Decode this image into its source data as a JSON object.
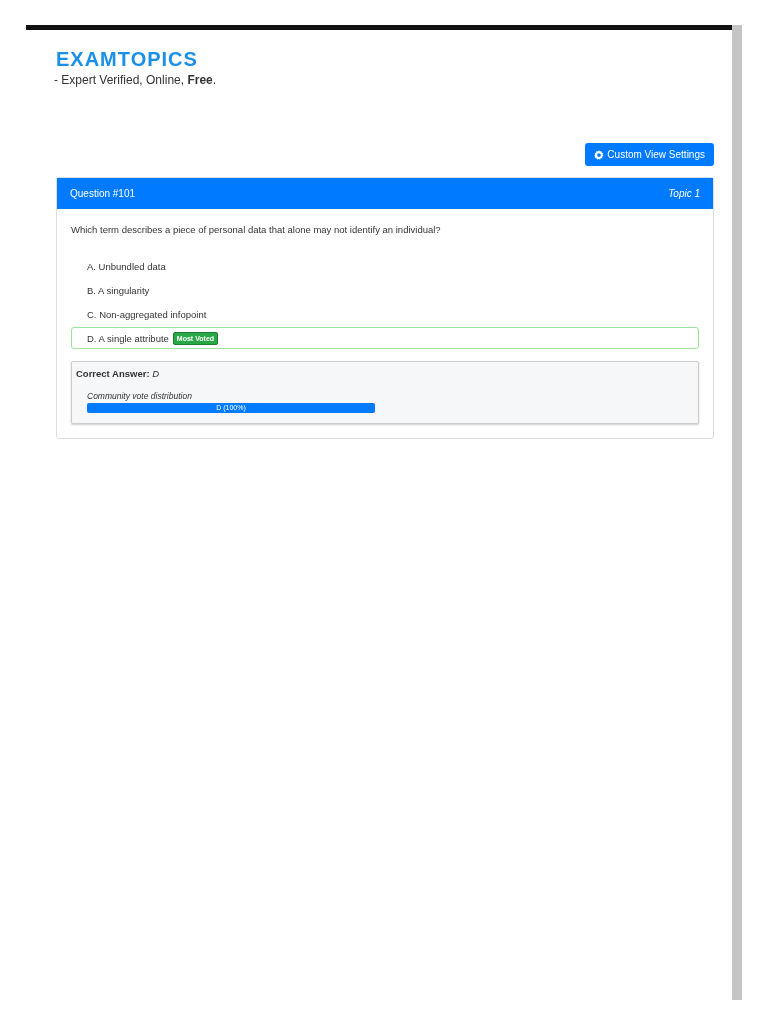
{
  "logo": "EXAMTOPICS",
  "tagline": "- Expert Verified, Online, **Free**.",
  "settings_button": "Custom View Settings",
  "question": {
    "number": "Question #101",
    "topic": "Topic 1",
    "text": "Which term describes a piece of personal data that alone may not identify an individual?",
    "options": [
      {
        "text": "A. Unbundled data",
        "highlighted": false
      },
      {
        "text": "B. A singularity",
        "highlighted": false
      },
      {
        "text": "C. Non-aggregated infopoint",
        "highlighted": false
      },
      {
        "text": "D. A single attribute",
        "highlighted": true,
        "badge": "Most Voted"
      }
    ],
    "answer": {
      "label": "Correct Answer:",
      "value": "D",
      "vote_title": "Community vote distribution",
      "votes": [
        {
          "label": "D (100%)"
        }
      ]
    }
  }
}
